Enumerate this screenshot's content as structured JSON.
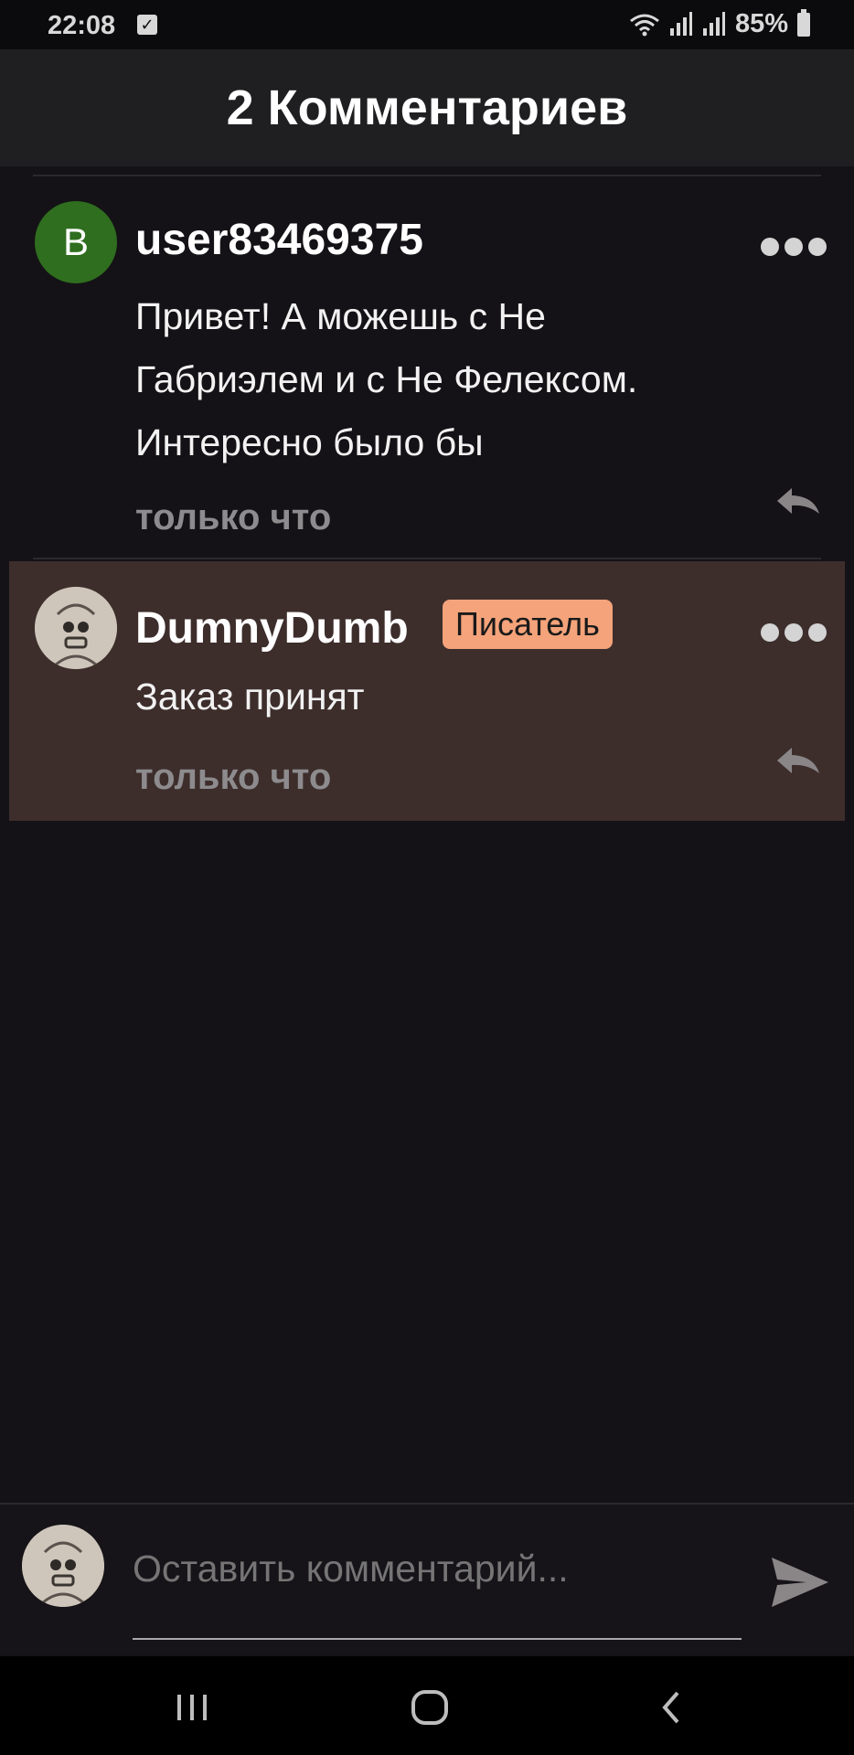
{
  "status_bar": {
    "time": "22:08",
    "battery": "85%"
  },
  "header": {
    "title": "2 Комментариев"
  },
  "comments": [
    {
      "avatar_letter": "B",
      "author": "user83469375",
      "text_lines": [
        "Привет! А можешь с Не",
        "Габриэлем и с Не Фелексом.",
        "Интересно было бы"
      ],
      "time": "только что"
    },
    {
      "author": "DumnyDumb",
      "badge": "Писатель",
      "text_lines": [
        "Заказ принят"
      ],
      "time": "только что"
    }
  ],
  "input": {
    "placeholder": "Оставить комментарий..."
  },
  "colors": {
    "background": "#141216",
    "header": "#1f1e21",
    "highlight": "#3d2e2c",
    "badge": "#f4a37a",
    "avatar_green": "#2f6e1f"
  },
  "icons": [
    "checkbox-notification-icon",
    "wifi-icon",
    "signal-icon",
    "battery-icon",
    "more-icon",
    "reply-icon",
    "send-icon",
    "recent-apps-icon",
    "home-icon",
    "back-icon"
  ]
}
